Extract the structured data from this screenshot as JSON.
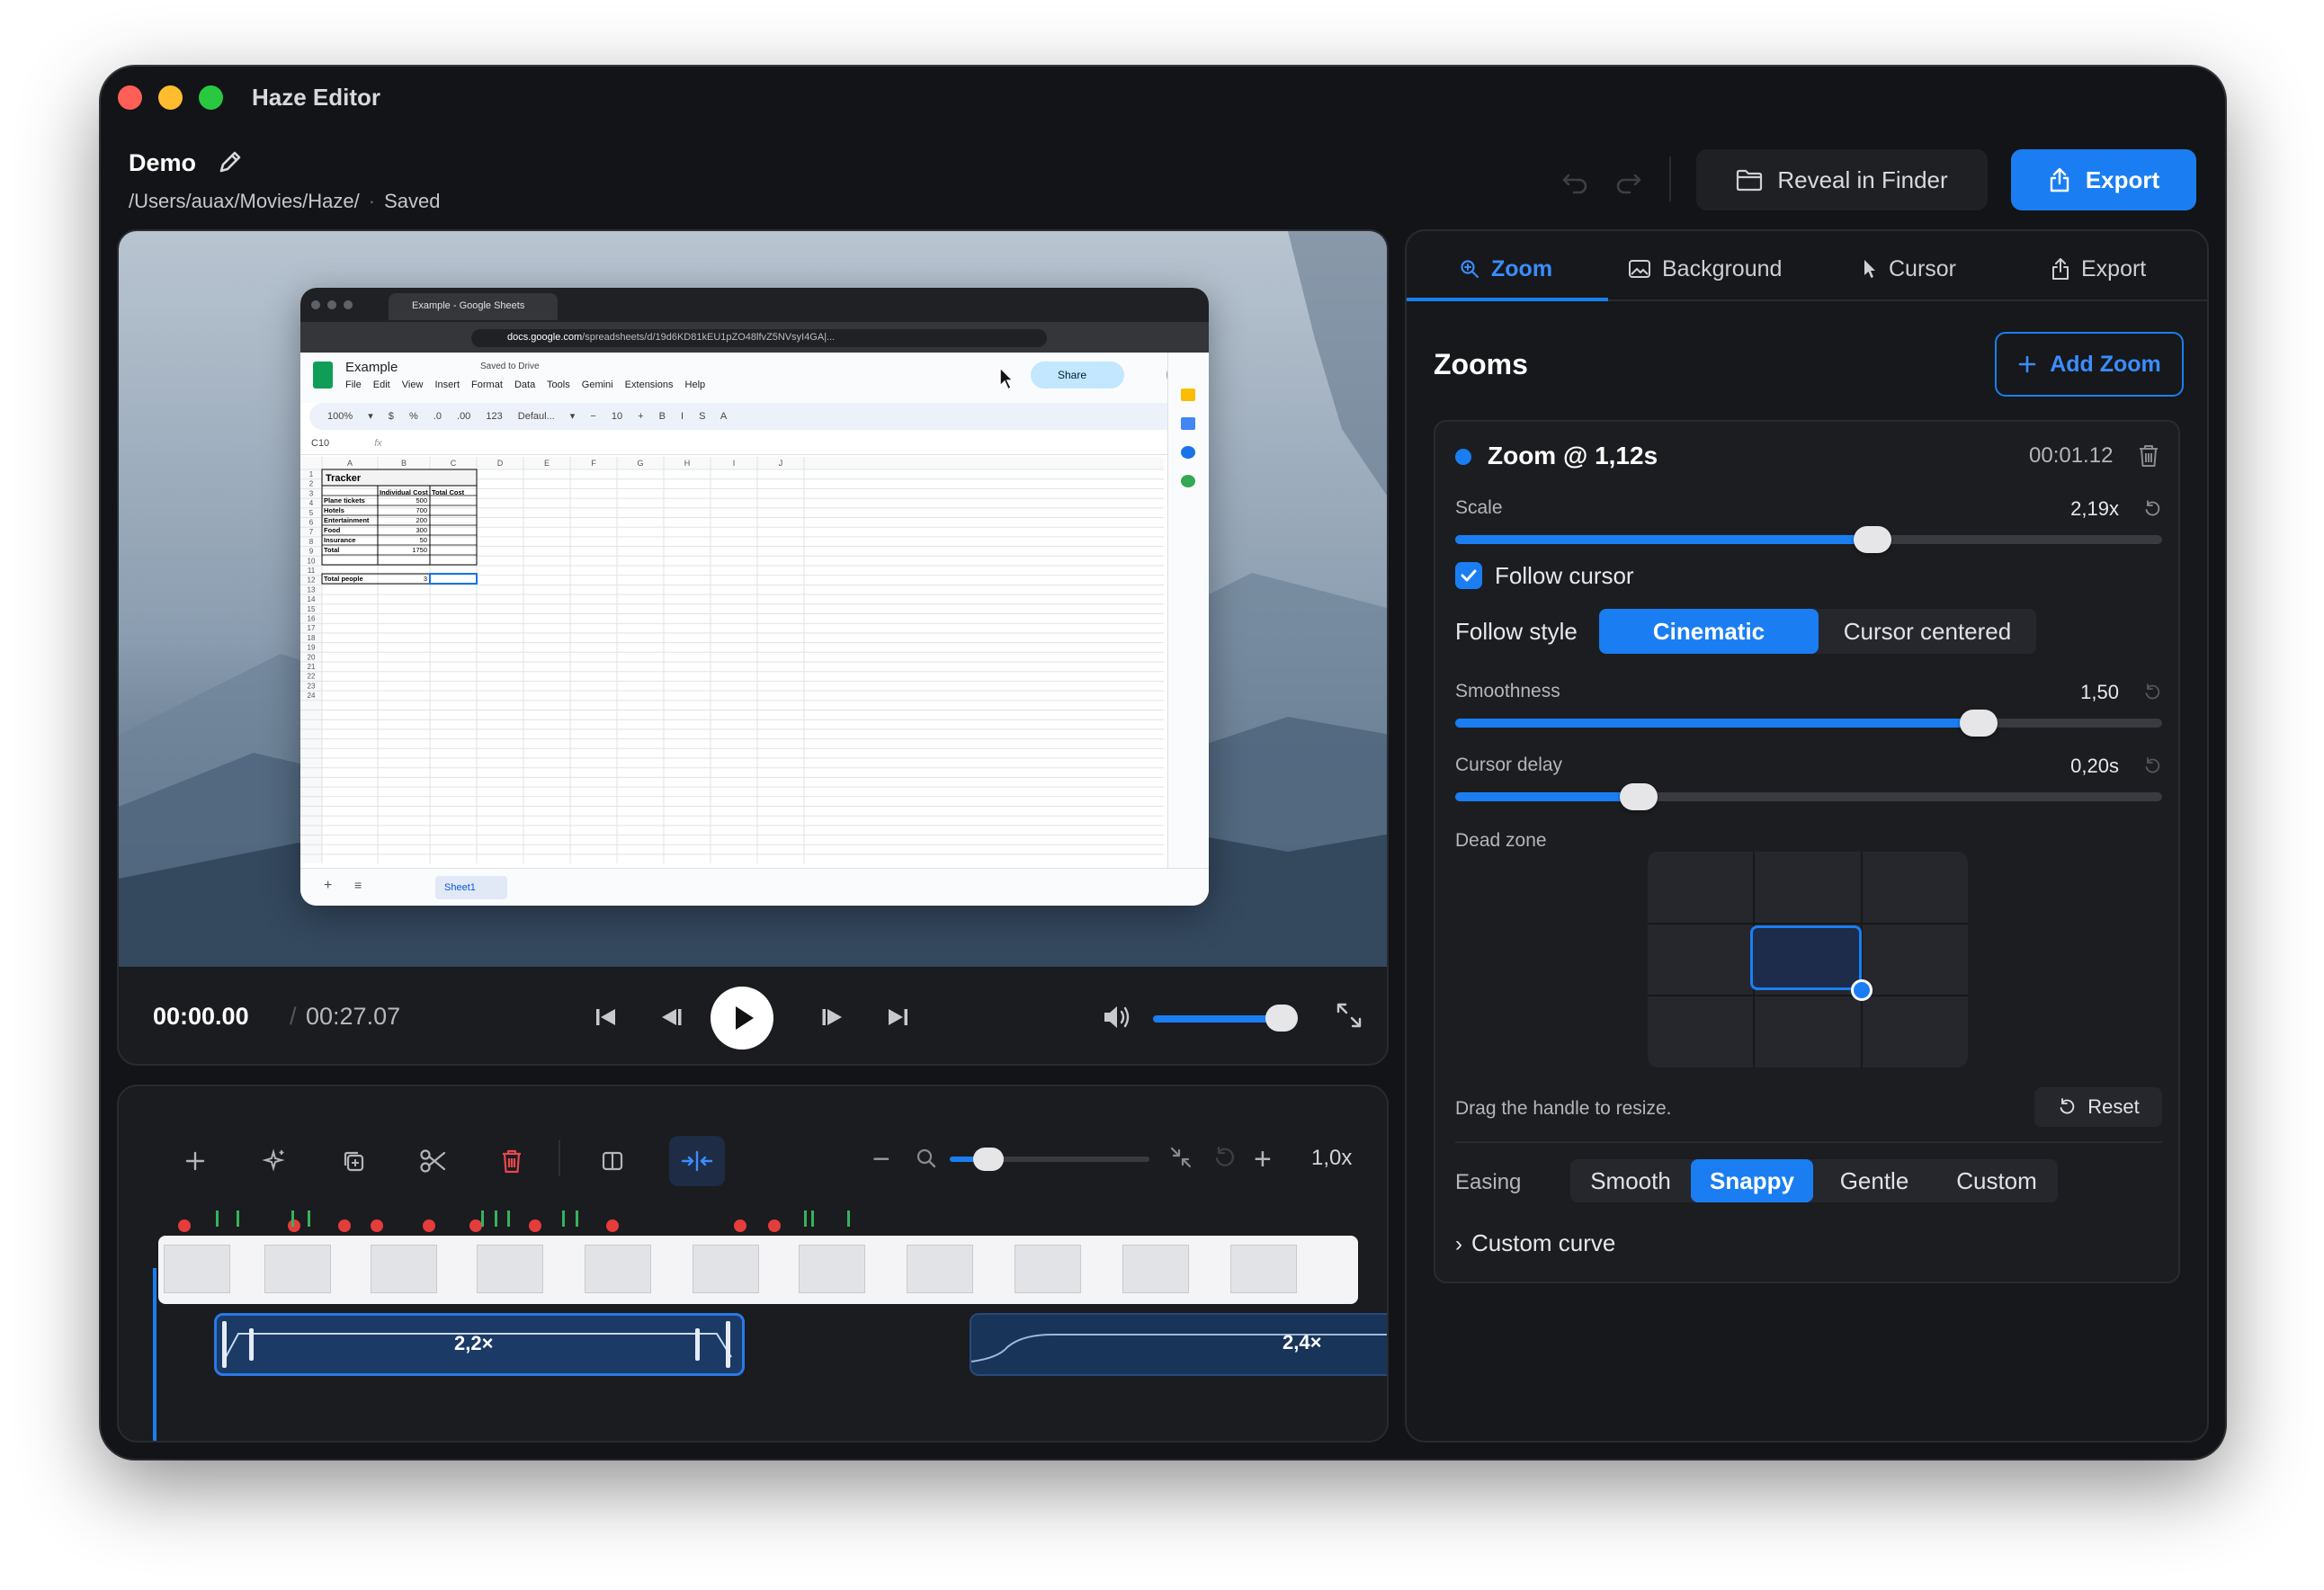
{
  "app": {
    "title": "Haze Editor"
  },
  "project": {
    "name": "Demo",
    "path": "/Users/auax/Movies/Haze/",
    "status": "Saved"
  },
  "header": {
    "reveal_label": "Reveal in Finder",
    "export_label": "Export"
  },
  "player": {
    "current_time": "00:00.00",
    "separator": "/",
    "total_time": "00:27.07",
    "volume": 0.88
  },
  "timeline": {
    "zoom_level": "1,0x",
    "zoom_clips": [
      {
        "label": "2,2×"
      },
      {
        "label": "2,4×"
      }
    ]
  },
  "panel": {
    "tabs": [
      {
        "label": "Zoom",
        "icon": "magnifier-icon",
        "active": true
      },
      {
        "label": "Background",
        "icon": "image-icon"
      },
      {
        "label": "Cursor",
        "icon": "pointer-icon"
      },
      {
        "label": "Export",
        "icon": "share-icon"
      }
    ],
    "section_title": "Zooms",
    "add_zoom_label": "Add Zoom",
    "zoom": {
      "title": "Zoom @ 1,12s",
      "time": "00:01.12",
      "scale_label": "Scale",
      "scale_value": "2,19x",
      "scale_fraction": 0.59,
      "follow_cursor_label": "Follow cursor",
      "follow_cursor": true,
      "follow_style_label": "Follow style",
      "follow_style_options": [
        "Cinematic",
        "Cursor centered"
      ],
      "follow_style_selected": "Cinematic",
      "smoothness_label": "Smoothness",
      "smoothness_value": "1,50",
      "smoothness_fraction": 0.74,
      "cursor_delay_label": "Cursor delay",
      "cursor_delay_value": "0,20s",
      "cursor_delay_fraction": 0.26,
      "dead_zone_label": "Dead zone",
      "dead_zone_hint": "Drag the handle to resize.",
      "reset_label": "Reset",
      "easing_label": "Easing",
      "easing_options": [
        "Smooth",
        "Snappy",
        "Gentle",
        "Custom"
      ],
      "easing_selected": "Snappy",
      "custom_curve_label": "Custom curve"
    }
  },
  "sheet": {
    "tab_title": "Example - Google Sheets",
    "url_prefix": "docs.google.com",
    "url_rest": "/spreadsheets/d/19d6KD81kEU1pZO48lfvZ5NVsyI4GA|...",
    "doc_title": "Example",
    "saved": "Saved to Drive",
    "menu": "File Edit View Insert Format Data Tools Gemini Extensions Help",
    "share": "Share",
    "toolbar": "100% ▾ $ % .0 .00 123 Defaul... ▾ − 10 + B I S A",
    "cell_ref": "C10",
    "columns": [
      "A",
      "B",
      "C",
      "D",
      "E",
      "F",
      "G",
      "H",
      "I",
      "J"
    ],
    "table_title": "Tracker",
    "col_b_header": "Individual Cost",
    "col_c_header": "Total Cost",
    "rows": [
      {
        "label": "Plane tickets",
        "value": "500"
      },
      {
        "label": "Hotels",
        "value": "700"
      },
      {
        "label": "Entertainment",
        "value": "200"
      },
      {
        "label": "Food",
        "value": "300"
      },
      {
        "label": "Insurance",
        "value": "50"
      },
      {
        "label": "Total",
        "value": "1750"
      }
    ],
    "total_people_label": "Total people",
    "total_people_value": "3",
    "sheet_tab": "Sheet1"
  },
  "colors": {
    "accent": "#1a7ef2",
    "window_bg": "#131417",
    "marker": "#e53c3c",
    "tick": "#35b35b"
  }
}
